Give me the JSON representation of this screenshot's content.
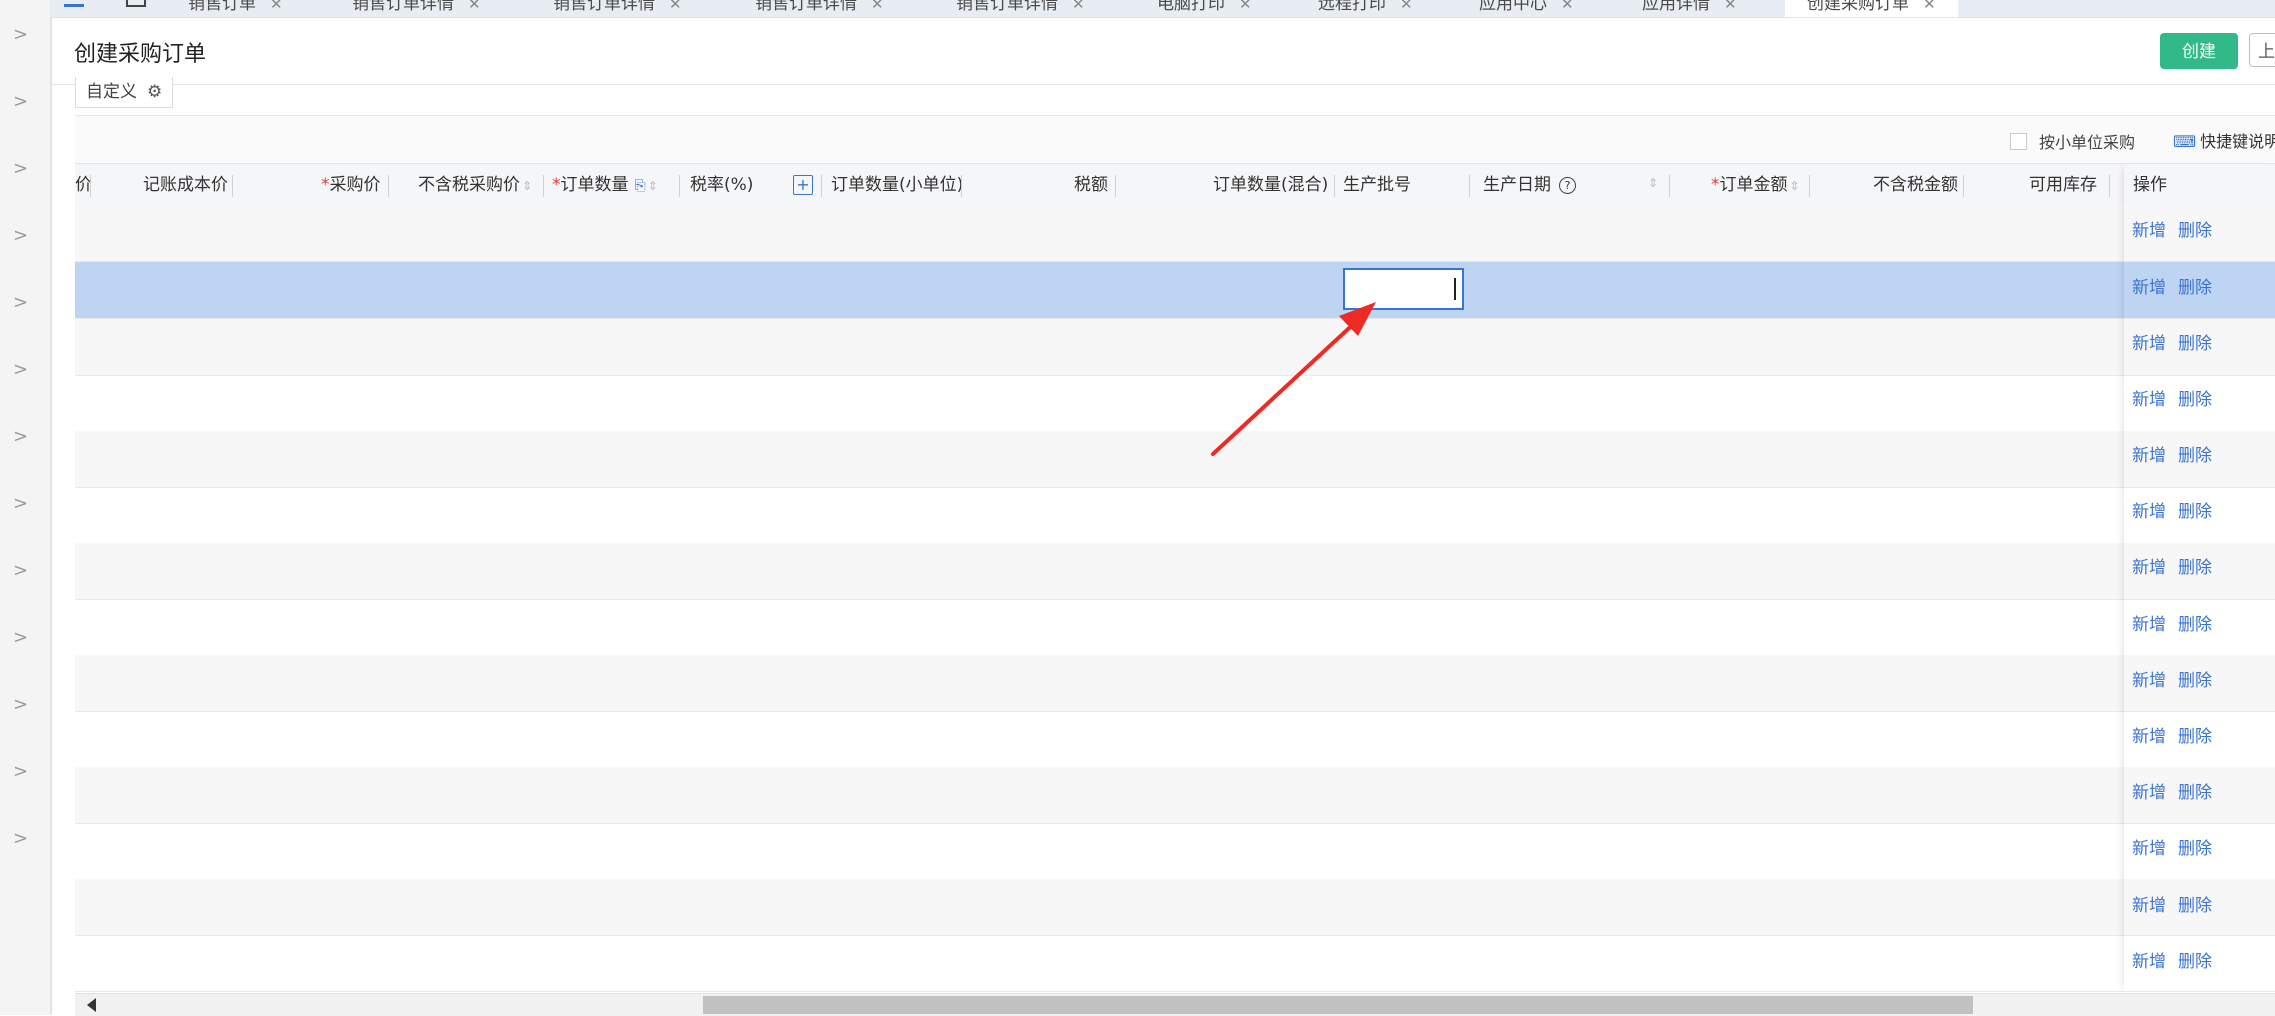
{
  "tabs": [
    {
      "label": "销售订单"
    },
    {
      "label": "销售订单详情"
    },
    {
      "label": "销售订单详情"
    },
    {
      "label": "销售订单详情"
    },
    {
      "label": "销售订单详情"
    },
    {
      "label": "电脑打印"
    },
    {
      "label": "远程打印"
    },
    {
      "label": "应用中心"
    },
    {
      "label": "应用详情"
    },
    {
      "label": "创建采购订单"
    }
  ],
  "header": {
    "title": "创建采购订单",
    "create_button": "创建",
    "prev_button": "上一"
  },
  "toolbar": {
    "customize_label": "自定义",
    "small_unit_label": "按小单位采购",
    "shortcut_label": "快捷键说明"
  },
  "table": {
    "columns": [
      {
        "label": "价"
      },
      {
        "label": "记账成本价"
      },
      {
        "label": "采购价",
        "required": "*"
      },
      {
        "label": "不含税采购价"
      },
      {
        "label": "订单数量",
        "required": "*"
      },
      {
        "label": "税率(%)"
      },
      {
        "label": "订单数量(小单位)"
      },
      {
        "label": "税额"
      },
      {
        "label": "订单数量(混合)"
      },
      {
        "label": "生产批号"
      },
      {
        "label": "生产日期"
      },
      {
        "label": "订单金额",
        "required": "*"
      },
      {
        "label": "不含税金额"
      },
      {
        "label": "可用库存"
      },
      {
        "label": "操作"
      }
    ],
    "row_actions": {
      "add": "新增",
      "delete": "删除"
    },
    "row_count": 14,
    "selected_row": 2,
    "focused_cell": "生产批号"
  },
  "colors": {
    "accent": "#3b73d4",
    "create_button": "#32b98a",
    "selected_row": "#bdd4f3",
    "required_mark": "#e53935",
    "annotation_arrow": "#ee2a24"
  }
}
